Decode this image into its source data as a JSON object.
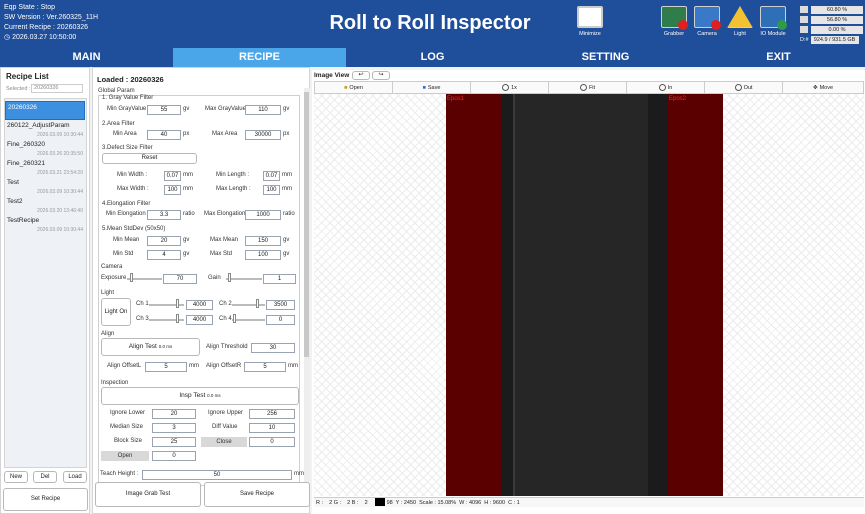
{
  "header": {
    "eqp_state": "Eqp State : Stop",
    "sw_version": "SW Version : Ver.260325_11H",
    "current_recipe": "Current Recipe : 20260326",
    "datetime": "2026.03.27 10:50:00",
    "title": "Roll to Roll Inspector",
    "icons": [
      {
        "name": "minimize-icon",
        "label": "Minimize"
      },
      {
        "name": "grabber-icon",
        "label": "Grabber"
      },
      {
        "name": "camera-icon",
        "label": "Camera"
      },
      {
        "name": "light-icon",
        "label": "Light"
      },
      {
        "name": "io-module-icon",
        "label": "IO Module"
      }
    ],
    "stats": [
      "60.80 %",
      "56.80 %",
      "0.00 %",
      "924.9 / 931.5 GB"
    ],
    "disk_label": "D:#"
  },
  "nav": {
    "tabs": [
      "MAIN",
      "RECIPE",
      "LOG",
      "SETTING",
      "EXIT"
    ],
    "active": "RECIPE"
  },
  "recipe_list": {
    "title": "Recipe List",
    "selected_label": "Selected :",
    "selected_value": "20260326",
    "items": [
      {
        "name": "20260326",
        "date": ""
      },
      {
        "name": "260122_AdjustParam",
        "date": "2026.03.09 10:30:44"
      },
      {
        "name": "Fine_260320",
        "date": "2026.03.26 20:35:50"
      },
      {
        "name": "Fine_260321",
        "date": "2026.03.21 23:54:20"
      },
      {
        "name": "Test",
        "date": "2026.03.09 10:30:44"
      },
      {
        "name": "Test2",
        "date": "2026.03.20 13:46:40"
      },
      {
        "name": "TestRecipe",
        "date": "2026.03.09 10:30:44"
      }
    ],
    "new": "New",
    "del": "Del",
    "load": "Load",
    "set_recipe": "Set Recipe"
  },
  "params": {
    "loaded": "Loaded : 20260326",
    "global": "Global Param",
    "gray": {
      "title": "1. Gray Value Filter",
      "min_label": "Min GrayValue",
      "min": "55",
      "min_unit": "gv",
      "max_label": "Max GrayValue",
      "max": "110",
      "max_unit": "gv"
    },
    "area": {
      "title": "2.Area Filter",
      "min_label": "Min Area",
      "min": "40",
      "min_unit": "px",
      "max_label": "Max Area",
      "max": "30000",
      "max_unit": "px"
    },
    "defect": {
      "title": "3.Defect Size Filter",
      "reset": "Reset",
      "min_w_label": "Min Width :",
      "min_w": "0.07",
      "min_l_label": "Min Length :",
      "min_l": "0.07",
      "max_w_label": "Max Width :",
      "max_w": "100",
      "max_l_label": "Max Length :",
      "max_l": "100",
      "unit": "mm"
    },
    "elong": {
      "title": "4.Elongation Filter",
      "min_label": "Min Elongation",
      "min": "3.3",
      "max_label": "Max Elongation",
      "max": "1000",
      "unit": "ratio"
    },
    "mean": {
      "title": "5.Mean StdDev (50x50)",
      "min_mean_label": "Min Mean",
      "min_mean": "20",
      "max_mean_label": "Max Mean",
      "max_mean": "150",
      "min_std_label": "Min Std",
      "min_std": "4",
      "max_std_label": "Max Std",
      "max_std": "100",
      "unit": "gv"
    },
    "camera": {
      "title": "Camera",
      "exposure_label": "Exposure",
      "exposure": "70",
      "gain_label": "Gain",
      "gain": "1"
    },
    "light": {
      "title": "Light",
      "light_on": "Light On",
      "ch1_label": "Ch 1",
      "ch1": "4000",
      "ch2_label": "Ch 2",
      "ch2": "3500",
      "ch3_label": "Ch 3",
      "ch3": "4000",
      "ch4_label": "Ch 4",
      "ch4": "0"
    },
    "align": {
      "title": "Align",
      "align_test": "Align Test",
      "align_time": "0.0 ms",
      "threshold_label": "Align Threshold",
      "threshold": "30",
      "offsetl_label": "Align OffsetL",
      "offsetl": "5",
      "offsetr_label": "Align OffsetR",
      "offsetr": "5",
      "unit": "mm"
    },
    "insp": {
      "title": "Inspection",
      "insp_test": "Insp Test",
      "insp_time": "0.0 ms",
      "ign_lower_label": "Ignore Lower",
      "ign_lower": "20",
      "ign_upper_label": "Ignore Upper",
      "ign_upper": "256",
      "median_label": "Median Size",
      "median": "3",
      "diff_label": "Diff Value",
      "diff": "10",
      "block_label": "Block Size",
      "block": "25",
      "close_label": "Close",
      "close": "0",
      "open_label": "Open",
      "open": "0"
    },
    "teach_label": "Teach Height :",
    "teach": "50",
    "teach_unit": "mm",
    "image_grab": "Image Grab Test",
    "save_recipe": "Save Recipe"
  },
  "image_view": {
    "title": "Image View",
    "buttons": [
      "Open",
      "Save",
      "1x",
      "Fit",
      "In",
      "Out",
      "Move"
    ],
    "roi1": "Epos1",
    "roi2": "Epos2",
    "status": "R :    2 G :    2 B :    2       X : 98  Y : 2450  Scale : 15.08%  W : 4096  H : 9600  C : 1"
  },
  "colors": {
    "header": "#1f4e9a",
    "active_tab": "#4aa6e8",
    "roi": "#5a0000"
  }
}
